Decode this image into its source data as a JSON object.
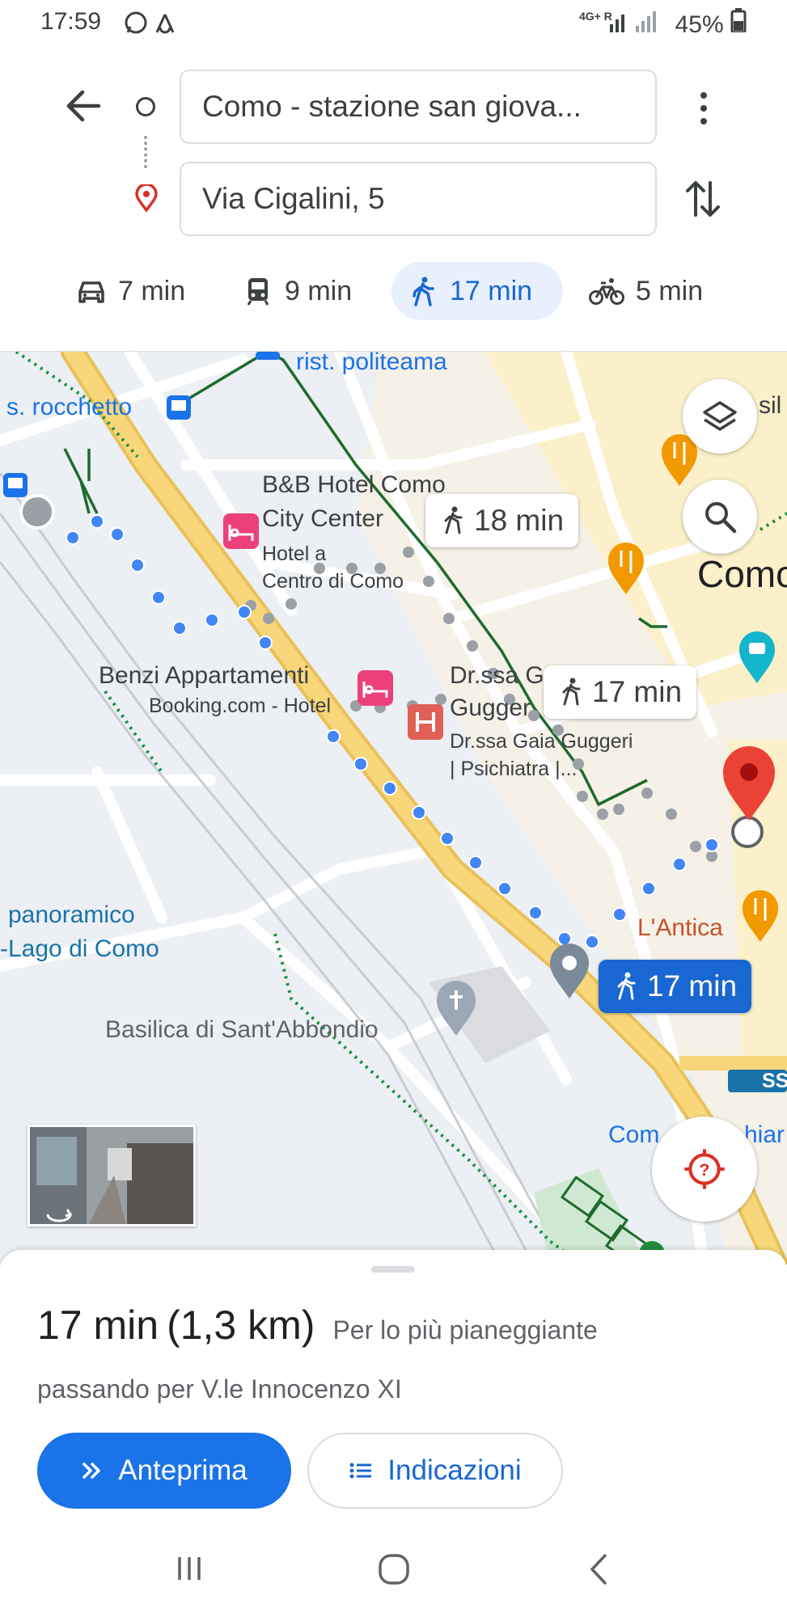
{
  "status": {
    "time": "17:59",
    "network": "4G+ R",
    "battery": "45%"
  },
  "directions": {
    "origin": "Como - stazione san giova...",
    "destination": "Via Cigalini, 5"
  },
  "modes": [
    {
      "name": "car",
      "time": "7 min"
    },
    {
      "name": "transit",
      "time": "9 min"
    },
    {
      "name": "walk",
      "time": "17 min",
      "active": true
    },
    {
      "name": "bike",
      "time": "5 min"
    }
  ],
  "map": {
    "labels": {
      "politeama": "rist. politeama",
      "rocchetto": "s. rocchetto",
      "sil": "sil",
      "bb_title_1": "B&B Hotel Como",
      "bb_title_2": "City Center",
      "bb_sub_1": "Hotel a",
      "bb_sub_2": "Centro di Como",
      "como": "Como",
      "benzi": "Benzi Appartamenti",
      "booking": "Booking.com - Hotel",
      "drssa_title_1": "Dr.ssa G",
      "drssa_title_2": "Gugger",
      "drssa_sub_1": "Dr.ssa Gaia Guggeri",
      "drssa_sub_2": "| Psichiatra |...",
      "panoramico_1": "panoramico",
      "panoramico_2": "-Lago di Como",
      "lantica": "L'Antica",
      "basilica": "Basilica di Sant'Abbondio",
      "ss": "SS",
      "com": "Com",
      "hiar": "hiar"
    },
    "route_bubbles": {
      "alt1": "18 min",
      "alt2": "17 min",
      "selected": "17 min"
    }
  },
  "sheet": {
    "duration": "17 min",
    "distance": "(1,3 km)",
    "terrain": "Per lo più pianeggiante",
    "via": "passando per V.le Innocenzo XI",
    "preview_button": "Anteprima",
    "steps_button": "Indicazioni"
  },
  "colors": {
    "accent": "#1a73e8",
    "route_dot": "#4285f4",
    "major_road": "#f8c24f",
    "pin_red": "#d93025"
  }
}
